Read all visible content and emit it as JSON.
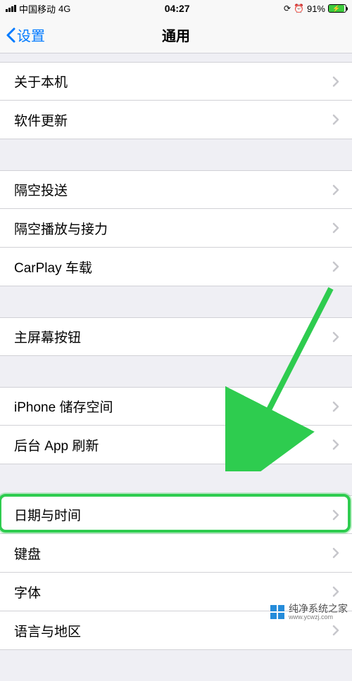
{
  "status": {
    "carrier": "中国移动",
    "network": "4G",
    "time": "04:27",
    "battery_pct": "91%"
  },
  "nav": {
    "back_label": "设置",
    "title": "通用"
  },
  "groups": [
    {
      "items": [
        {
          "key": "about",
          "label": "关于本机"
        },
        {
          "key": "software_update",
          "label": "软件更新"
        }
      ]
    },
    {
      "items": [
        {
          "key": "airdrop",
          "label": "隔空投送"
        },
        {
          "key": "airplay_handoff",
          "label": "隔空播放与接力"
        },
        {
          "key": "carplay",
          "label": "CarPlay 车载"
        }
      ]
    },
    {
      "items": [
        {
          "key": "home_button",
          "label": "主屏幕按钮"
        }
      ]
    },
    {
      "items": [
        {
          "key": "iphone_storage",
          "label": "iPhone 储存空间"
        },
        {
          "key": "background_refresh",
          "label": "后台 App 刷新"
        }
      ]
    },
    {
      "items": [
        {
          "key": "date_time",
          "label": "日期与时间",
          "highlighted": true
        },
        {
          "key": "keyboard",
          "label": "键盘"
        },
        {
          "key": "fonts",
          "label": "字体"
        },
        {
          "key": "language_region",
          "label": "语言与地区"
        }
      ]
    }
  ],
  "annotation": {
    "arrow_color": "#2ecc4f",
    "highlight_color": "#2ecc4f"
  },
  "watermark": {
    "title": "纯净系统之家",
    "subtitle": "www.ycwzj.com"
  }
}
